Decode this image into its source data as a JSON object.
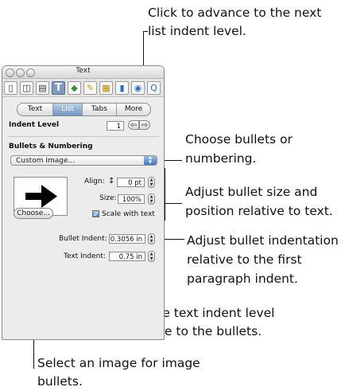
{
  "window": {
    "title": "Text",
    "toolbar_icons": [
      "document-icon",
      "layout-icon",
      "graphic-icon",
      "text-icon",
      "shapes-icon",
      "pencil-icon",
      "table-icon",
      "chart-icon",
      "link-icon",
      "quicktime-icon"
    ],
    "text_icon_glyph": "T"
  },
  "tabs": [
    {
      "label": "Text",
      "selected": false
    },
    {
      "label": "List",
      "selected": true
    },
    {
      "label": "Tabs",
      "selected": false
    },
    {
      "label": "More",
      "selected": false
    }
  ],
  "indent": {
    "label": "Indent Level",
    "value": "1"
  },
  "bullets": {
    "section_label": "Bullets & Numbering",
    "popup_value": "Custom Image...",
    "align_label": "Align:",
    "align_value": "0 pt",
    "size_label": "Size:",
    "size_value": "100%",
    "scale_label": "Scale with text",
    "scale_checked": true,
    "choose_label": "Choose..."
  },
  "indents": {
    "bullet_label": "Bullet Indent:",
    "bullet_value": "0.3056 in",
    "text_label": "Text Indent:",
    "text_value": "0.75 in"
  },
  "callouts": {
    "advance_1": "Click to advance to the next",
    "advance_2": "list indent level.",
    "choose_1": "Choose bullets or",
    "choose_2": "numbering.",
    "size_1": "Adjust bullet size and",
    "size_2": "position relative to text.",
    "indent_1": "Adjust bullet indentation",
    "indent_2": "relative to the first",
    "indent_3": "paragraph indent.",
    "textindent_1": "Set the text indent level",
    "textindent_2": "relative to the bullets.",
    "image_1": "Select an image for image",
    "image_2": "bullets."
  }
}
